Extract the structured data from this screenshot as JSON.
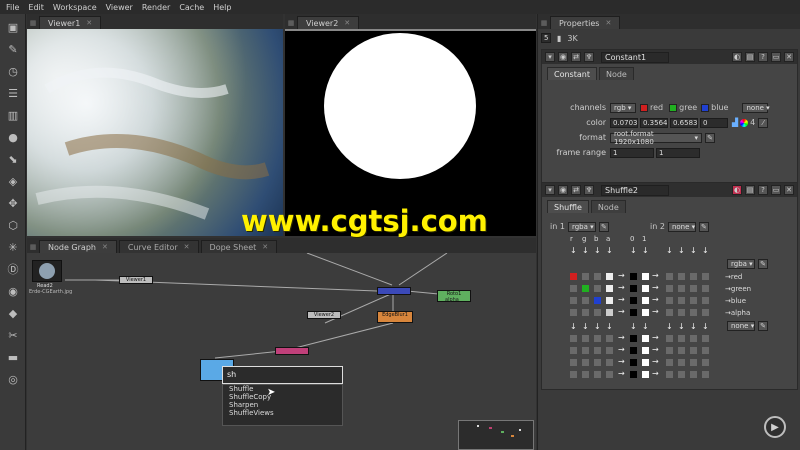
{
  "menu": [
    "File",
    "Edit",
    "Workspace",
    "Viewer",
    "Render",
    "Cache",
    "Help"
  ],
  "viewer1_tab": "Viewer1",
  "viewer2_tab": "Viewer2",
  "properties_tab": "Properties",
  "properties_bar": [
    "5",
    "3K"
  ],
  "node_tabs": [
    "Node Graph",
    "Curve Editor",
    "Dope Sheet"
  ],
  "constant": {
    "name": "Constant1",
    "tabs": [
      "Constant",
      "Node"
    ],
    "channels_label": "channels",
    "channels_value": "rgb",
    "channel_checks": [
      "red",
      "gree",
      "blue"
    ],
    "channels_extra": "none",
    "color_label": "color",
    "color_values": [
      "0.07030",
      "0.3564",
      "0.65837",
      "0"
    ],
    "color_count": "4",
    "format_label": "format",
    "format_value": "root.format 1920x1080",
    "frame_range_label": "frame range",
    "frame_range": [
      "1",
      "1"
    ]
  },
  "shuffle": {
    "name": "Shuffle2",
    "tabs": [
      "Shuffle",
      "Node"
    ],
    "in1_label": "in 1",
    "in1_value": "rgba",
    "in2_label": "in 2",
    "in2_value": "none",
    "col_headers_left": [
      "r",
      "g",
      "b",
      "a"
    ],
    "col_headers_mid": [
      "0",
      "1"
    ],
    "out1_value": "rgba",
    "out_channels": [
      "red",
      "green",
      "blue",
      "alpha"
    ],
    "out2_value": "none"
  },
  "nodes": {
    "read": "Read2",
    "read_file": "Erde-CGEarth.jpg",
    "viewer1": "Viewer1",
    "viewer2": "Viewer2",
    "edgeblur": "EdgeBlur1",
    "roto": "Roto1",
    "roto_sub": "alpha"
  },
  "search": {
    "typed": "sh",
    "suggestions": [
      "Shuffle",
      "ShuffleCopy",
      "Sharpen",
      "ShuffleViews"
    ]
  },
  "watermark": "www.cgtsj.com",
  "colors": {
    "accent_yellow": "#fff100",
    "red": "#d02020",
    "green": "#20b020",
    "blue": "#2040d0"
  }
}
